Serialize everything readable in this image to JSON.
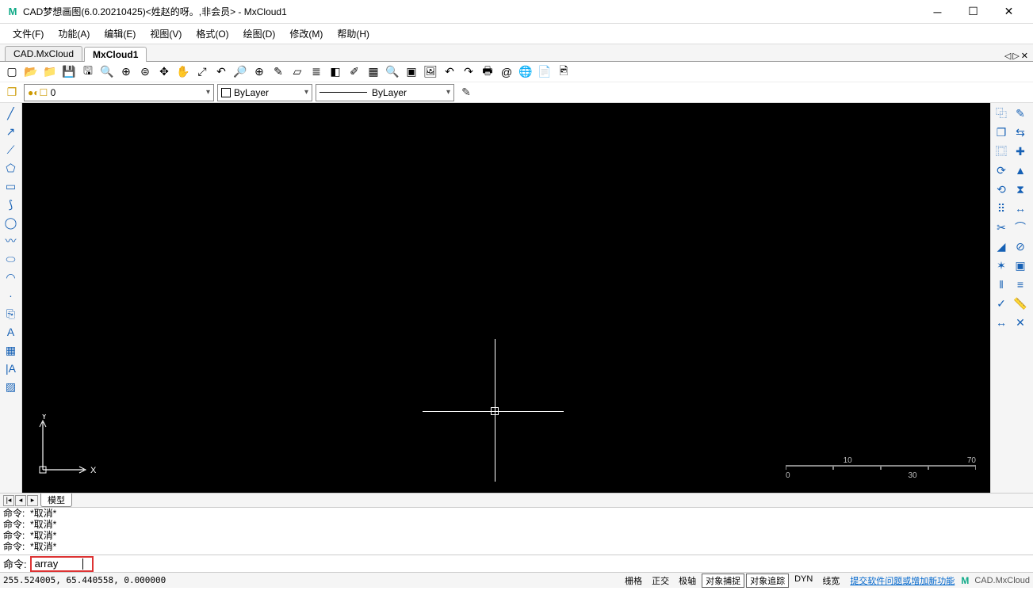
{
  "window": {
    "title": "CAD梦想画图(6.0.20210425)<姓赵的呀。,非会员> - MxCloud1"
  },
  "menu": {
    "items": [
      "文件(F)",
      "功能(A)",
      "编辑(E)",
      "视图(V)",
      "格式(O)",
      "绘图(D)",
      "修改(M)",
      "帮助(H)"
    ]
  },
  "tabs": {
    "items": [
      "CAD.MxCloud",
      "MxCloud1"
    ],
    "active_index": 1
  },
  "layer_bar": {
    "layer_combo": "0",
    "color_combo": "ByLayer",
    "linetype_combo": "ByLayer"
  },
  "viewport": {
    "scale_ticks": [
      "0",
      "10",
      "30",
      "70"
    ],
    "ucs": {
      "y": "Y",
      "x": "X"
    }
  },
  "model_tabs": {
    "items": [
      "模型"
    ]
  },
  "command_history": [
    "命令:  *取消*",
    "命令:  *取消*",
    "命令:  *取消*",
    "命令:  *取消*"
  ],
  "command_line": {
    "prompt": "命令:",
    "value": "array"
  },
  "status": {
    "coords": "255.524005,  65.440558,  0.000000",
    "toggles": [
      "栅格",
      "正交",
      "极轴",
      "对象捕捉",
      "对象追踪",
      "DYN",
      "线宽"
    ],
    "boxed_indices": [
      3,
      4
    ],
    "link": "提交软件问题或增加新功能",
    "brand": "CAD.MxCloud"
  },
  "icons": {
    "toolbar1": [
      "new",
      "open",
      "openf",
      "save",
      "saveas",
      "zoomw",
      "zoomin",
      "zoomall",
      "zoomext",
      "pan",
      "zoomd",
      "prev",
      "zoom",
      "target",
      "pencil",
      "eraser",
      "layers",
      "grad",
      "brush",
      "hatch",
      "find",
      "block",
      "img",
      "undo",
      "redo",
      "print",
      "att",
      "globe",
      "pdf",
      "img2"
    ],
    "left_tools": [
      "line",
      "xline",
      "pline",
      "polygon",
      "rect",
      "arc",
      "circle",
      "spline",
      "ellipse",
      "ellarc",
      "point",
      "insert",
      "mtext",
      "table",
      "vtext",
      "hatch2"
    ],
    "right_tools": [
      "copy",
      "edit",
      "copy2",
      "swap",
      "copy3",
      "plus",
      "rotate",
      "scale",
      "refresh",
      "mirror",
      "array",
      "stretch",
      "trim",
      "fillet",
      "chamfer",
      "break",
      "explode",
      "group",
      "offset",
      "align",
      "match",
      "measure",
      "dist",
      "erase2"
    ]
  }
}
